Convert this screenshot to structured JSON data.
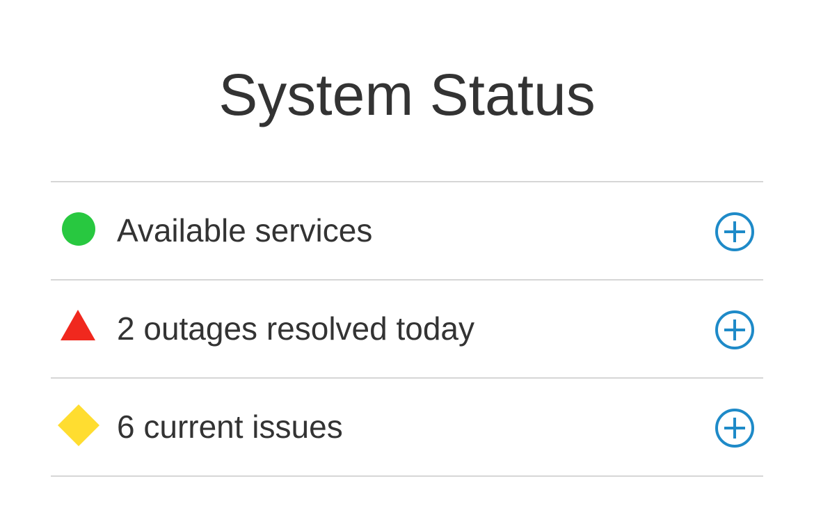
{
  "title": "System Status",
  "colors": {
    "ok": "#28c840",
    "outage": "#f0281e",
    "issue": "#ffdd30",
    "expand": "#1e8ac8",
    "divider": "#d6d6d6",
    "text": "#333333"
  },
  "items": [
    {
      "label": "Available services",
      "icon": "green-circle-icon"
    },
    {
      "label": "2 outages resolved today",
      "icon": "red-triangle-icon"
    },
    {
      "label": "6 current issues",
      "icon": "yellow-diamond-icon"
    }
  ],
  "expand_icon": "plus-circle-icon"
}
